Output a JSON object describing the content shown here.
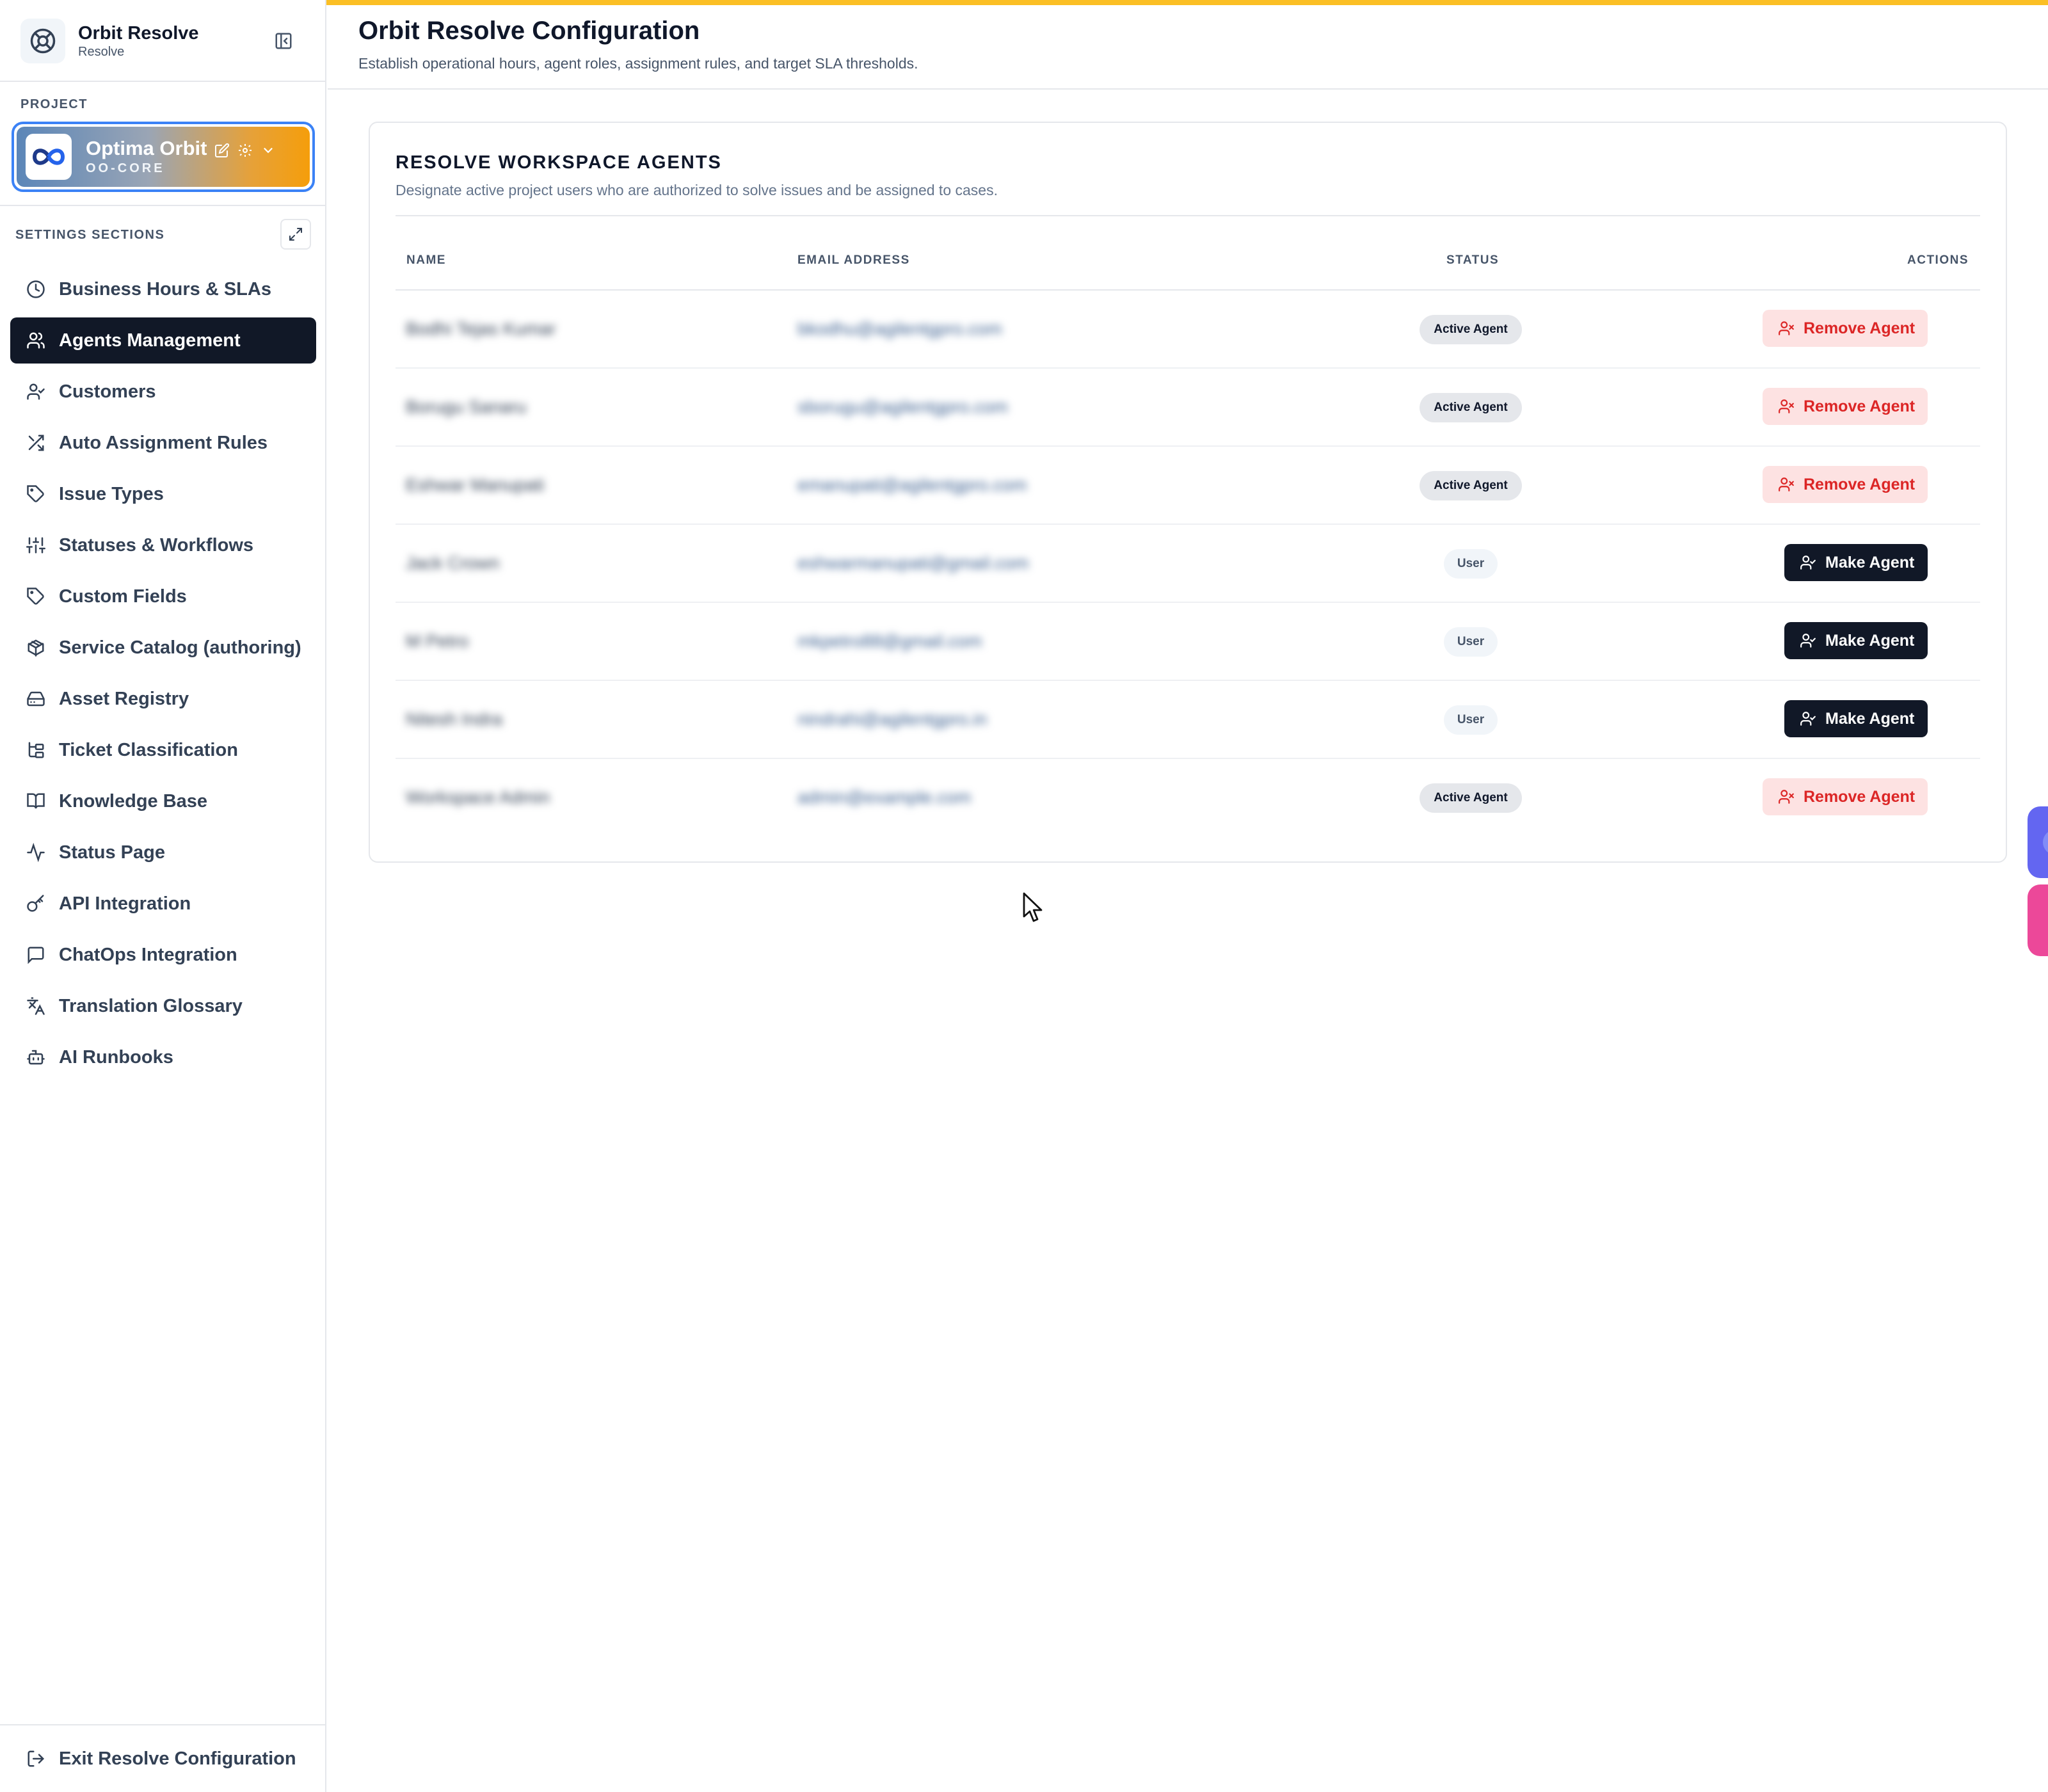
{
  "app": {
    "title": "Orbit Resolve",
    "subtitle": "Resolve"
  },
  "sidebar": {
    "project_label": "PROJECT",
    "project": {
      "name": "Optima Orbit",
      "code": "OO-CORE"
    },
    "sections_label": "SETTINGS SECTIONS",
    "items": [
      {
        "label": "Business Hours & SLAs",
        "icon": "clock-icon",
        "active": false
      },
      {
        "label": "Agents Management",
        "icon": "users-icon",
        "active": true
      },
      {
        "label": "Customers",
        "icon": "user-check-icon",
        "active": false
      },
      {
        "label": "Auto Assignment Rules",
        "icon": "shuffle-icon",
        "active": false
      },
      {
        "label": "Issue Types",
        "icon": "tag-icon",
        "active": false
      },
      {
        "label": "Statuses & Workflows",
        "icon": "sliders-icon",
        "active": false
      },
      {
        "label": "Custom Fields",
        "icon": "tag-icon",
        "active": false
      },
      {
        "label": "Service Catalog (authoring)",
        "icon": "package-icon",
        "active": false
      },
      {
        "label": "Asset Registry",
        "icon": "hard-drive-icon",
        "active": false
      },
      {
        "label": "Ticket Classification",
        "icon": "folder-tree-icon",
        "active": false
      },
      {
        "label": "Knowledge Base",
        "icon": "book-icon",
        "active": false
      },
      {
        "label": "Status Page",
        "icon": "activity-icon",
        "active": false
      },
      {
        "label": "API Integration",
        "icon": "key-icon",
        "active": false
      },
      {
        "label": "ChatOps Integration",
        "icon": "message-square-icon",
        "active": false
      },
      {
        "label": "Translation Glossary",
        "icon": "languages-icon",
        "active": false
      },
      {
        "label": "AI Runbooks",
        "icon": "bot-icon",
        "active": false
      }
    ],
    "exit_label": "Exit Resolve Configuration"
  },
  "header": {
    "title": "Orbit Resolve Configuration",
    "subtitle": "Establish operational hours, agent roles, assignment rules, and target SLA thresholds."
  },
  "agents": {
    "title": "RESOLVE WORKSPACE AGENTS",
    "subtitle": "Designate active project users who are authorized to solve issues and be assigned to cases.",
    "columns": [
      "NAME",
      "EMAIL ADDRESS",
      "STATUS",
      "ACTIONS"
    ],
    "rows": [
      {
        "name": "Bodhi Tejas Kumar",
        "email": "bkodhu@agilentgpro.com",
        "status": "Active Agent",
        "action": "Remove Agent"
      },
      {
        "name": "Borugu Sanaru",
        "email": "sborugu@agilentgpro.com",
        "status": "Active Agent",
        "action": "Remove Agent"
      },
      {
        "name": "Eshwar Manupati",
        "email": "emanupati@agilentgpro.com",
        "status": "Active Agent",
        "action": "Remove Agent"
      },
      {
        "name": "Jack Crown",
        "email": "eshwarmanupati@gmail.com",
        "status": "User",
        "action": "Make Agent"
      },
      {
        "name": "M Petro",
        "email": "mkpetro88@gmail.com",
        "status": "User",
        "action": "Make Agent"
      },
      {
        "name": "Nitesh Indra",
        "email": "nindrahi@agilentgpro.in",
        "status": "User",
        "action": "Make Agent"
      },
      {
        "name": "Workspace Admin",
        "email": "admin@example.com",
        "status": "Active Agent",
        "action": "Remove Agent"
      }
    ]
  },
  "colors": {
    "accent_bar": "#fbbf24",
    "active_nav": "#111827",
    "remove_bg": "#fde2e2",
    "remove_text": "#dc2626"
  }
}
